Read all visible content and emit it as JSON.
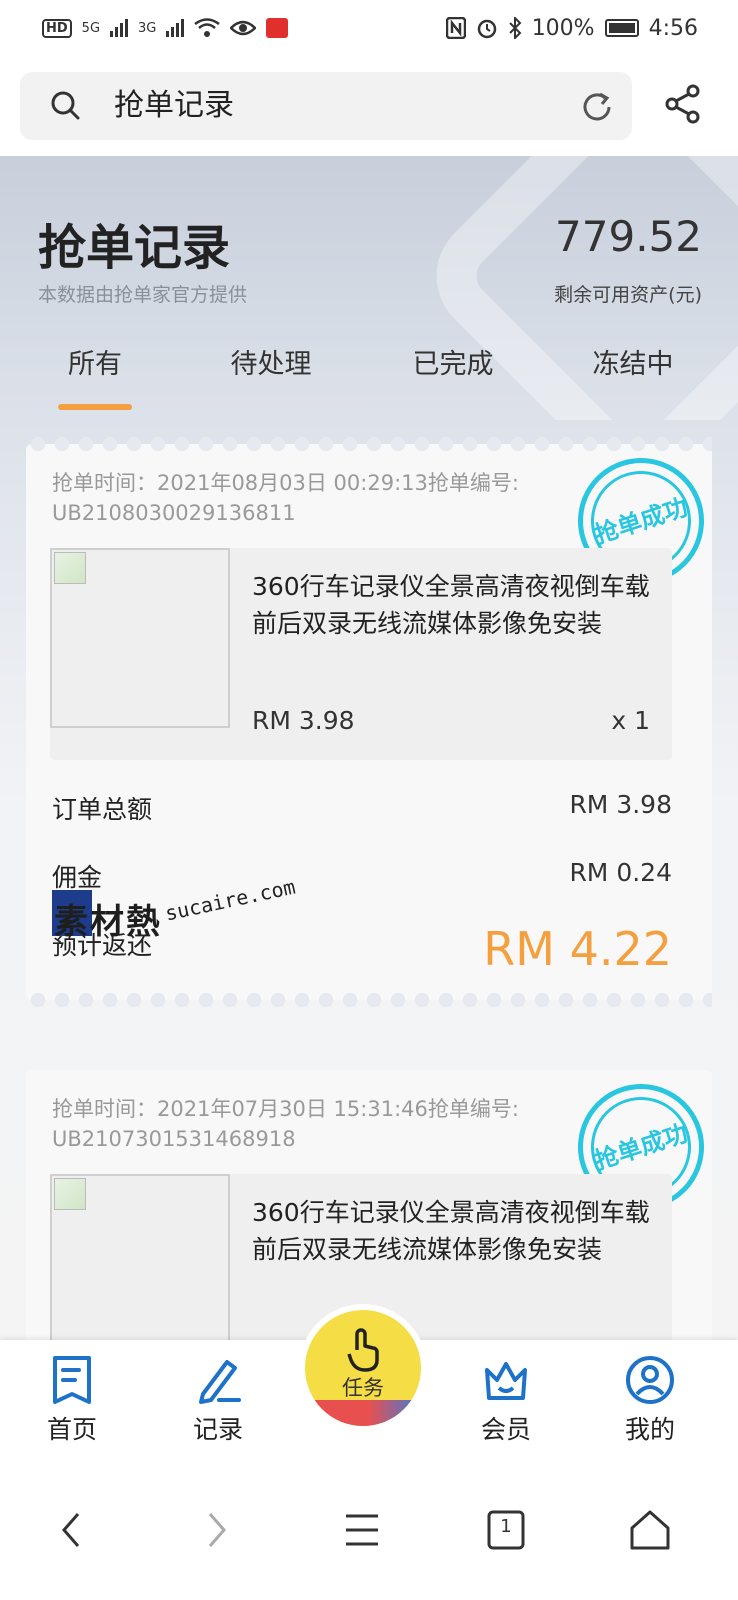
{
  "status_bar": {
    "network_5g": "5G",
    "network_3g": "3G",
    "battery": "100%",
    "time": "4:56"
  },
  "search": {
    "query": "抢单记录"
  },
  "header": {
    "title": "抢单记录",
    "subtitle": "本数据由抢单家官方提供",
    "balance": "779.52",
    "balance_label": "剩余可用资产(元)",
    "tabs": [
      "所有",
      "待处理",
      "已完成",
      "冻结中"
    ],
    "active_tab": "所有",
    "accent_color": "#f5a040"
  },
  "orders": [
    {
      "meta_line1": "抢单时间：2021年08月03日 00:29:13抢单编号:",
      "meta_line2": "UB2108030029136811",
      "stamp": "抢单成功",
      "product_name": "360行车记录仪全景高清夜视倒车载前后双录无线流媒体影像免安装",
      "price": "RM 3.98",
      "qty": "x 1",
      "total_label": "订单总额",
      "total_value": "RM 3.98",
      "commission_label": "佣金",
      "commission_value": "RM 0.24",
      "refund_label": "预计返还",
      "refund_value": "RM 4.22"
    },
    {
      "meta_line1": "抢单时间：2021年07月30日 15:31:46抢单编号:",
      "meta_line2": "UB2107301531468918",
      "stamp": "抢单成功",
      "product_name": "360行车记录仪全景高清夜视倒车载前后双录无线流媒体影像免安装"
    }
  ],
  "watermark": {
    "text": "素材熱",
    "url": "sucaire.com"
  },
  "bottom_nav": {
    "items": [
      "首页",
      "记录",
      "会员",
      "我的"
    ],
    "center_label": "任务"
  },
  "system_nav": {
    "tab_count": "1"
  }
}
